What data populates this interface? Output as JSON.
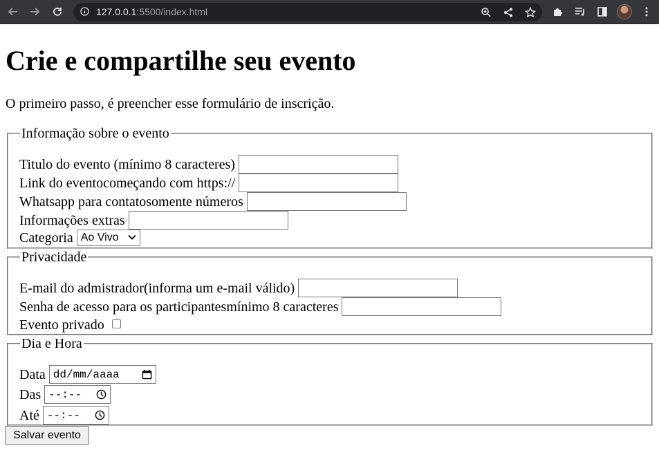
{
  "browser": {
    "url_host": "127.0.0.1",
    "url_rest": ":5500/index.html",
    "icons": {
      "back": "arrow-left-icon",
      "forward": "arrow-right-icon",
      "reload": "reload-icon",
      "site_info": "info-icon",
      "zoom": "zoom-icon",
      "share": "share-icon",
      "bookmark": "star-icon",
      "extensions": "puzzle-icon",
      "media": "media-control-icon",
      "side_panel": "side-panel-icon",
      "profile": "avatar",
      "menu": "kebab-menu-icon"
    }
  },
  "page": {
    "title": "Crie e compartilhe seu evento",
    "intro": "O primeiro passo, é preencher esse formulário de inscrição."
  },
  "fieldsets": {
    "evento": {
      "legend": "Informação sobre o evento",
      "titulo_label": "Titulo do evento (mínimo 8 caracteres)",
      "titulo_value": "",
      "link_label": "Link do eventocomeçando com https://",
      "link_value": "",
      "whatsapp_label": "Whatsapp para contatosomente números",
      "whatsapp_value": "",
      "extras_label": "Informações extras",
      "extras_value": "",
      "categoria_label": "Categoria",
      "categoria_value": "Ao Vivo"
    },
    "privacidade": {
      "legend": "Privacidade",
      "email_label": "E-mail do admistrador(informa um e-mail válido)",
      "email_value": "",
      "senha_label": "Senha de acesso para os participantesmínimo 8 caracteres",
      "senha_value": "",
      "privado_label": "Evento privado",
      "privado_checked": false
    },
    "dia_hora": {
      "legend": "Dia e Hora",
      "data_label": "Data",
      "data_placeholder": "dd/mm/aaaa",
      "das_label": "Das",
      "das_placeholder": "--:--",
      "ate_label": "Até",
      "ate_placeholder": "--:--"
    }
  },
  "actions": {
    "save_label": "Salvar evento"
  }
}
